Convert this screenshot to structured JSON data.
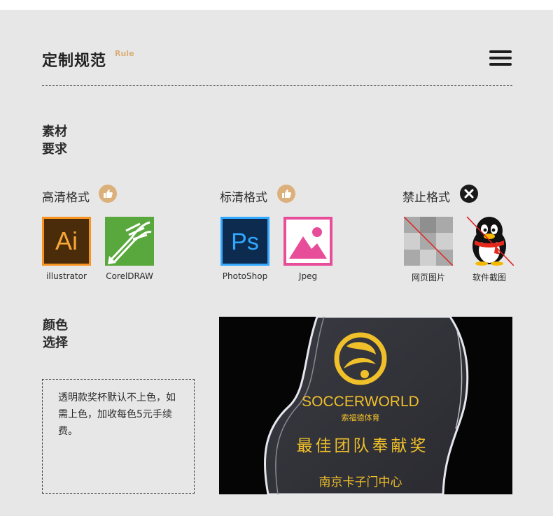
{
  "header": {
    "title": "定制规范",
    "subtitle": "Rule",
    "menu_icon": "hamburger-menu-icon"
  },
  "material_section": {
    "title_line1": "素材",
    "title_line2": "要求",
    "groups": [
      {
        "label": "高清格式",
        "badge_icon": "thumbs-up-icon",
        "items": [
          {
            "icon": "adobe-illustrator-icon",
            "glyph": "Ai",
            "caption": "illustrator"
          },
          {
            "icon": "coreldraw-icon",
            "caption": "CorelDRAW"
          }
        ]
      },
      {
        "label": "标清格式",
        "badge_icon": "thumbs-up-icon",
        "items": [
          {
            "icon": "adobe-photoshop-icon",
            "glyph": "Ps",
            "caption": "PhotoShop"
          },
          {
            "icon": "jpeg-image-icon",
            "caption": "Jpeg"
          }
        ]
      },
      {
        "label": "禁止格式",
        "badge_icon": "x-mark-icon",
        "items": [
          {
            "icon": "web-image-placeholder-icon",
            "caption": "网页图片"
          },
          {
            "icon": "qq-penguin-icon",
            "caption": "软件截图"
          }
        ]
      }
    ]
  },
  "color_section": {
    "title_line1": "颜色",
    "title_line2": "选择",
    "note": "透明款奖杯默认不上色，如需上色，加收每色5元手续费。"
  },
  "photo": {
    "brand": "SOCCERWORLD",
    "brand_cn": "索福德体育",
    "award_text": "最佳团队奉献奖",
    "org_text": "南京卡子门中心"
  },
  "colors": {
    "accent_gold": "#dbb07b",
    "panel_bg": "#e7e7e7",
    "photo_gold": "#f0c02a"
  }
}
